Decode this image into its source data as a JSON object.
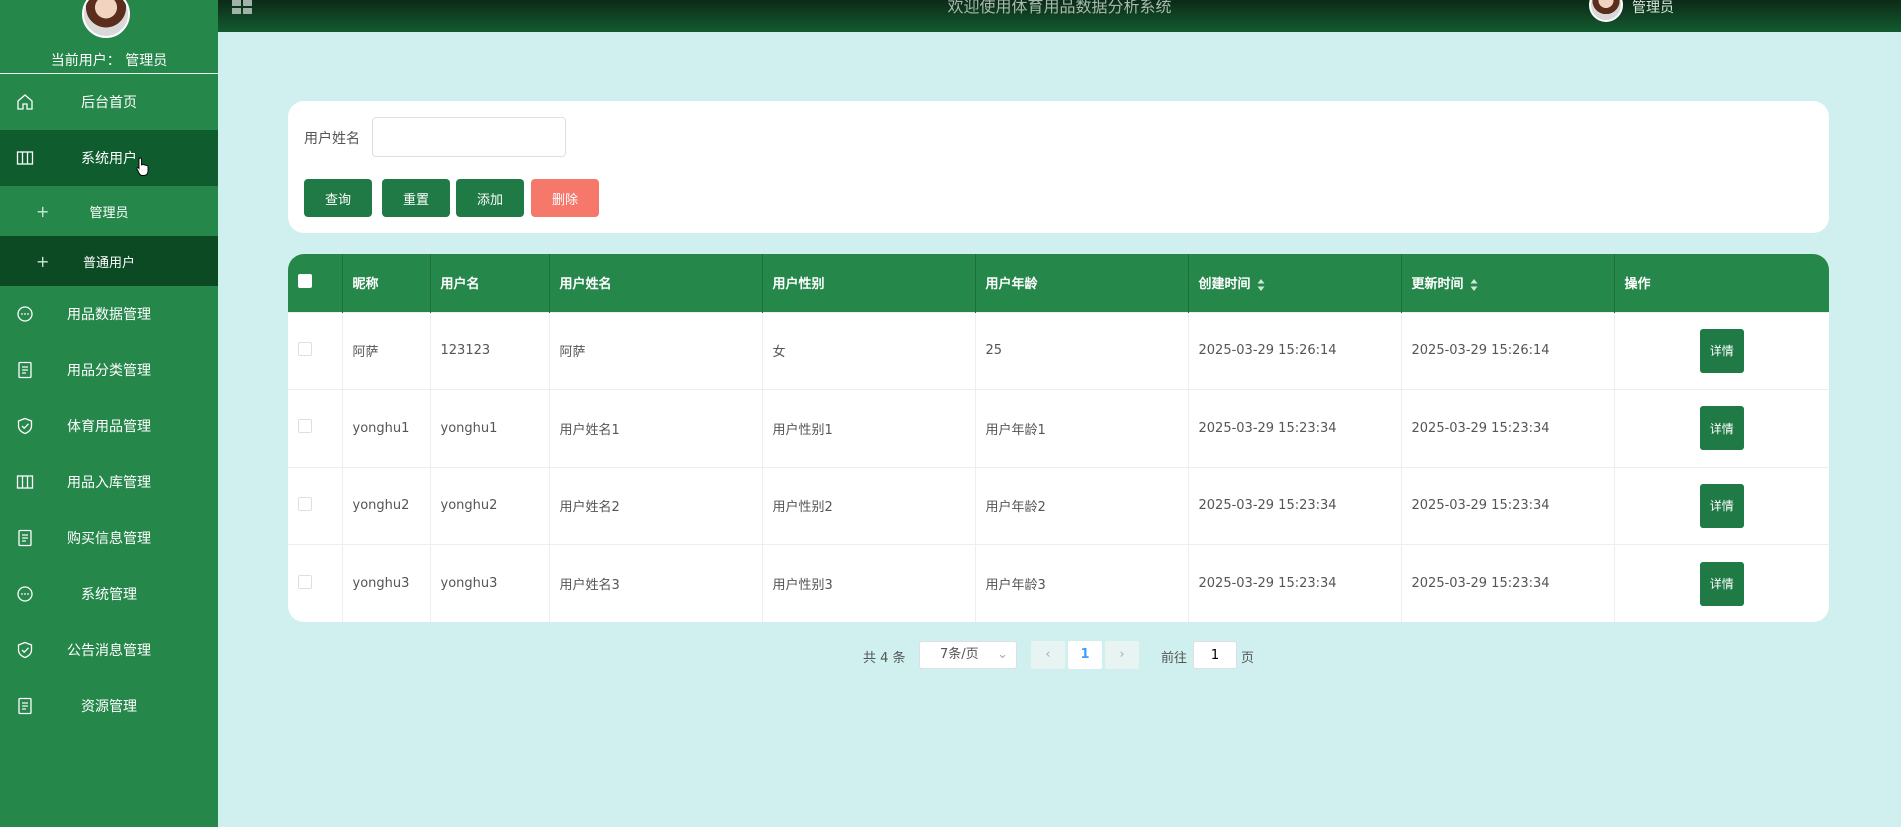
{
  "header": {
    "title": "欢迎使用体育用品数据分析系统",
    "user": "管理员"
  },
  "sidebar": {
    "current_user": "当前用户： 管理员",
    "items": [
      {
        "label": "后台首页",
        "icon": "home-icon"
      },
      {
        "label": "系统用户",
        "icon": "columns-icon"
      },
      {
        "label": "用品数据管理",
        "icon": "chat-icon"
      },
      {
        "label": "用品分类管理",
        "icon": "document-icon"
      },
      {
        "label": "体育用品管理",
        "icon": "shield-check-icon"
      },
      {
        "label": "用品入库管理",
        "icon": "columns-icon"
      },
      {
        "label": "购买信息管理",
        "icon": "document-icon"
      },
      {
        "label": "系统管理",
        "icon": "chat-icon"
      },
      {
        "label": "公告消息管理",
        "icon": "shield-check-icon"
      },
      {
        "label": "资源管理",
        "icon": "document-icon"
      }
    ],
    "sub_items": [
      {
        "label": "管理员"
      },
      {
        "label": "普通用户"
      }
    ]
  },
  "search": {
    "label": "用户姓名",
    "value": "",
    "placeholder": "",
    "buttons": {
      "query": "查询",
      "reset": "重置",
      "add": "添加",
      "delete": "删除"
    }
  },
  "table": {
    "columns": [
      "昵称",
      "用户名",
      "用户姓名",
      "用户性别",
      "用户年龄",
      "创建时间",
      "更新时间",
      "操作"
    ],
    "rows": [
      {
        "nickname": "阿萨",
        "username": "123123",
        "name": "阿萨",
        "gender": "女",
        "age": "25",
        "created": "2025-03-29 15:26:14",
        "updated": "2025-03-29 15:26:14",
        "action": "详情"
      },
      {
        "nickname": "yonghu1",
        "username": "yonghu1",
        "name": "用户姓名1",
        "gender": "用户性别1",
        "age": "用户年龄1",
        "created": "2025-03-29 15:23:34",
        "updated": "2025-03-29 15:23:34",
        "action": "详情"
      },
      {
        "nickname": "yonghu2",
        "username": "yonghu2",
        "name": "用户姓名2",
        "gender": "用户性别2",
        "age": "用户年龄2",
        "created": "2025-03-29 15:23:34",
        "updated": "2025-03-29 15:23:34",
        "action": "详情"
      },
      {
        "nickname": "yonghu3",
        "username": "yonghu3",
        "name": "用户姓名3",
        "gender": "用户性别3",
        "age": "用户年龄3",
        "created": "2025-03-29 15:23:34",
        "updated": "2025-03-29 15:23:34",
        "action": "详情"
      }
    ]
  },
  "pagination": {
    "total": "共 4 条",
    "page_size": "7条/页",
    "current_page": "1",
    "goto": "前往",
    "jump_value": "1",
    "page_word": "页"
  },
  "colors": {
    "sidebar": "#25874a",
    "sidebar_active": "#0f5d2e",
    "background": "#cff0ee",
    "primary_button": "#1f7a45",
    "danger_button": "#f5786b"
  }
}
